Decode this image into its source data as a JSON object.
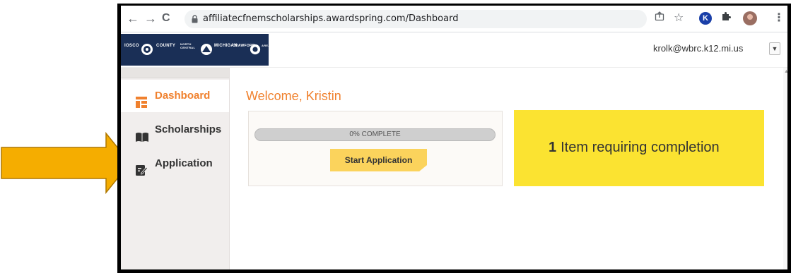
{
  "browser": {
    "url": "affiliatecfnemscholarships.awardspring.com/Dashboard",
    "extension_k_label": "K"
  },
  "header": {
    "logo_words": [
      "IOSCO",
      "COUNTY",
      "NORTH CENTRAL",
      "MICHIGAN",
      "CRAWFORD",
      "AREA"
    ],
    "user_email": "krolk@wbrc.k12.mi.us"
  },
  "sidebar": {
    "items": [
      {
        "label": "Dashboard",
        "icon": "dashboard-icon",
        "active": true
      },
      {
        "label": "Scholarships",
        "icon": "book-icon",
        "active": false
      },
      {
        "label": "Application",
        "icon": "edit-icon",
        "active": false
      }
    ]
  },
  "main": {
    "welcome": "Welcome, Kristin",
    "progress": {
      "label": "0% COMPLETE",
      "value": 0
    },
    "start_button": "Start Application",
    "completion": {
      "count": "1",
      "text": "Item requiring completion"
    }
  },
  "colors": {
    "accent": "#f0812e",
    "logo_bg": "#1a2f56",
    "button": "#fbd35c",
    "completion_bg": "#fbe331",
    "annotation_arrow": "#f5ad00"
  }
}
